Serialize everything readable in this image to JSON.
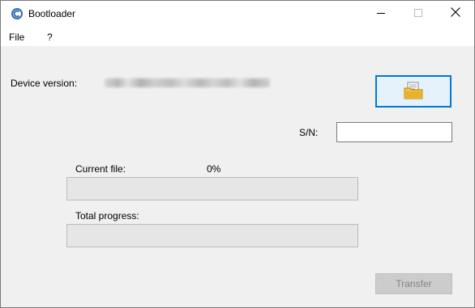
{
  "window": {
    "title": "Bootloader",
    "app_icon": "bootloader-app-icon",
    "controls": [
      "minimize-icon",
      "maximize-icon",
      "close-icon"
    ]
  },
  "menu": {
    "file_label": "File",
    "help_label": "?"
  },
  "device": {
    "version_label": "Device version:"
  },
  "open_button": {
    "icon": "folder-document-icon"
  },
  "serial": {
    "label": "S/N:",
    "value": ""
  },
  "current_file": {
    "label": "Current file:",
    "percent_text": "0%",
    "progress": 0
  },
  "total_progress": {
    "label": "Total progress:",
    "progress": 0
  },
  "transfer_button": {
    "label": "Transfer",
    "enabled": false
  },
  "colors": {
    "accent": "#0078d7",
    "progress_fill": "#06b025",
    "disabled_text": "#838383"
  }
}
